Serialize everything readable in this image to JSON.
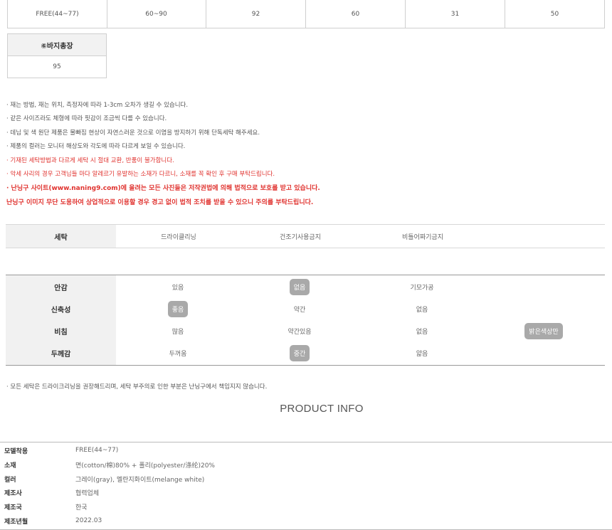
{
  "size_table": {
    "cells": [
      "FREE(44~77)",
      "60~90",
      "92",
      "60",
      "31",
      "50"
    ]
  },
  "pants_length": {
    "header": "⑥바지총장",
    "value": "95"
  },
  "notes": [
    "· 재는 방법, 재는 위치, 측정자에 따라 1-3cm 오차가 생길 수 있습니다.",
    "· 같은 사이즈라도 체형에 따라 핏감이 조금씩 다를 수 있습니다.",
    "· 데님 및 색 원단 제품은 물빠짐 현상이 자연스러운 것으로 이염을 방지하기 위해 단독세탁 해주세요.",
    "· 제품의 컬러는 모니터 해상도와 각도에 따라 다르게 보일 수 있습니다.",
    "· 기재된 세탁방법과 다르게 세탁 시 절대 교환, 반품이 불가합니다.",
    "· 악세 사리의 경우 고객님들 마다 알레르기 유발하는 소재가 다르니, 소재를 꼭 확인 후 구매 부탁드립니다.",
    "· 난닝구 사이트(www.naning9.com)에 올려는 모든 사진들은 저작권법에 의해 법적으로 보호를 받고 있습니다.",
    "난닝구 이미지 무단 도용하여 상업적으로 이용할 경우 경고 없이 법적 조치를 받을 수 있으니 주의를 부탁드립니다."
  ],
  "wash": {
    "label": "세탁",
    "options": [
      "드라이클리닝",
      "건조기사용금지",
      "비틀어짜기금지"
    ]
  },
  "attributes": [
    {
      "label": "안감",
      "options": [
        "있음",
        "없음",
        "기모가공",
        ""
      ],
      "selected": [
        1
      ]
    },
    {
      "label": "신축성",
      "options": [
        "좋음",
        "약간",
        "없음",
        ""
      ],
      "selected": [
        0
      ]
    },
    {
      "label": "비침",
      "options": [
        "많음",
        "약간있음",
        "없음",
        "밝은색상만"
      ],
      "selected": [
        3
      ]
    },
    {
      "label": "두께감",
      "options": [
        "두꺼움",
        "중간",
        "얇음",
        ""
      ],
      "selected": [
        1
      ]
    }
  ],
  "wash_disclaimer": "· 모든 세탁은 드라이크리닝을 권장해드리며, 세탁 부주의로 인한 부분은 난닝구에서 책임지지 않습니다.",
  "product_info": {
    "title": "PRODUCT INFO",
    "rows": [
      {
        "key": "모델착용",
        "value": "FREE(44~77)"
      },
      {
        "key": "소재",
        "value": "면(cotton/棉)80% + 폴리(polyester/涤纶)20%"
      },
      {
        "key": "컬러",
        "value": "그레이(gray), 멜란지화이트(melange white)"
      },
      {
        "key": "제조사",
        "value": "협력업체"
      },
      {
        "key": "제조국",
        "value": "한국"
      },
      {
        "key": "제조년월",
        "value": "2022.03"
      }
    ]
  },
  "colors": {
    "pill_bg": "#a9a9a9",
    "warning_red": "#e0332f",
    "label_bg": "#f1f1f1"
  }
}
